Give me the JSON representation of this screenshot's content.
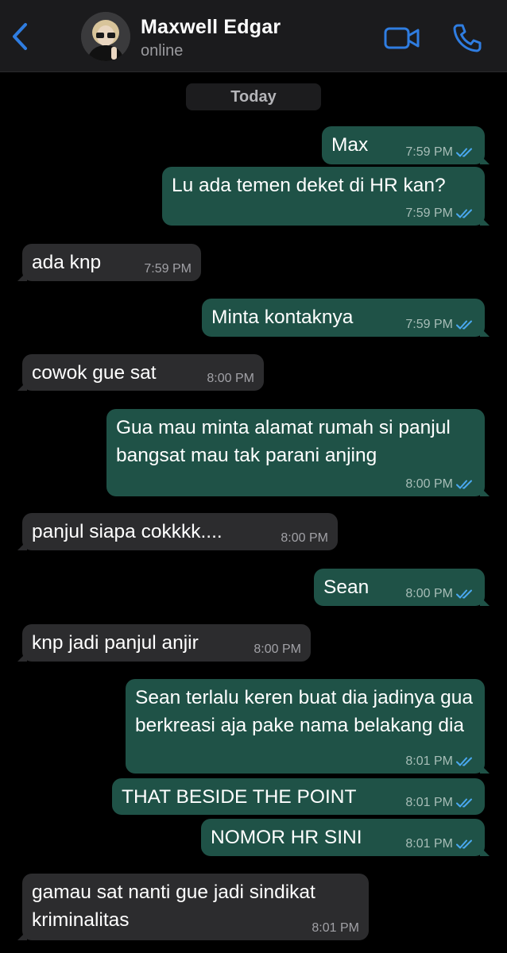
{
  "header": {
    "contact_name": "Maxwell Edgar",
    "status": "online",
    "back_icon": "chevron-left-icon",
    "video_icon": "video-camera-icon",
    "call_icon": "phone-icon",
    "accent_color": "#2f7de1"
  },
  "date_divider": "Today",
  "messages": [
    {
      "dir": "out",
      "text": "Max",
      "time": "7:59 PM",
      "read": true
    },
    {
      "dir": "out",
      "text": "Lu ada temen deket di HR kan?",
      "time": "7:59 PM",
      "read": true
    },
    {
      "dir": "in",
      "text": "ada knp",
      "time": "7:59 PM"
    },
    {
      "dir": "out",
      "text": "Minta kontaknya",
      "time": "7:59 PM",
      "read": true
    },
    {
      "dir": "in",
      "text": "cowok gue sat",
      "time": "8:00 PM"
    },
    {
      "dir": "out",
      "text": "Gua mau minta alamat rumah si panjul bangsat mau tak parani anjing",
      "time": "8:00 PM",
      "read": true
    },
    {
      "dir": "in",
      "text": "panjul siapa cokkkk....",
      "time": "8:00 PM"
    },
    {
      "dir": "out",
      "text": "Sean",
      "time": "8:00 PM",
      "read": true
    },
    {
      "dir": "in",
      "text": "knp jadi panjul anjir",
      "time": "8:00 PM"
    },
    {
      "dir": "out",
      "text": "Sean terlalu keren buat dia jadinya gua berkreasi aja pake nama belakang dia",
      "time": "8:01 PM",
      "read": true
    },
    {
      "dir": "out",
      "text": "THAT BESIDE THE POINT",
      "time": "8:01 PM",
      "read": true
    },
    {
      "dir": "out",
      "text": "NOMOR HR SINI",
      "time": "8:01 PM",
      "read": true
    },
    {
      "dir": "in",
      "text": "gamau sat nanti gue jadi sindikat kriminalitas",
      "time": "8:01 PM"
    }
  ]
}
